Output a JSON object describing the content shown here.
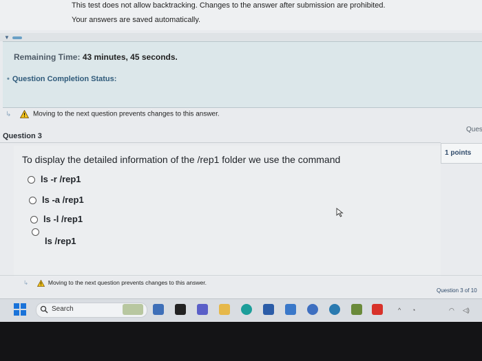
{
  "header": {
    "backtrack_notice_prefix": "This test does not allow backtracking. Changes to the answer after submission are prohibited.",
    "save_notice": "Your answers are saved automatically."
  },
  "status": {
    "remaining_label": "Remaining Time:",
    "remaining_value": "43 minutes, 45 seconds.",
    "completion_label": "Question Completion Status:"
  },
  "warning": {
    "top": "Moving to the next question prevents changes to this answer.",
    "bottom": "Moving to the next question prevents changes to this answer."
  },
  "question": {
    "title": "Question 3",
    "side_label": "Ques",
    "points": "1 points",
    "text": "To display the detailed information of the /rep1 folder we use the command",
    "options": [
      "ls -r /rep1",
      "ls -a /rep1",
      "ls -l /rep1",
      "ls /rep1"
    ],
    "progress": "Question 3 of 10"
  },
  "taskbar": {
    "search_label": "Search",
    "icons": [
      "widgets-icon",
      "game-icon",
      "store-icon",
      "file-explorer-icon",
      "teams-icon",
      "folder-icon",
      "edge-icon",
      "store-bag-icon",
      "app-icon",
      "browser-icon",
      "vpn-icon",
      "brush-icon",
      "office-icon"
    ],
    "tray_icons": [
      "chevron-up-icon",
      "network-icon",
      "wifi-icon",
      "volume-icon"
    ]
  }
}
